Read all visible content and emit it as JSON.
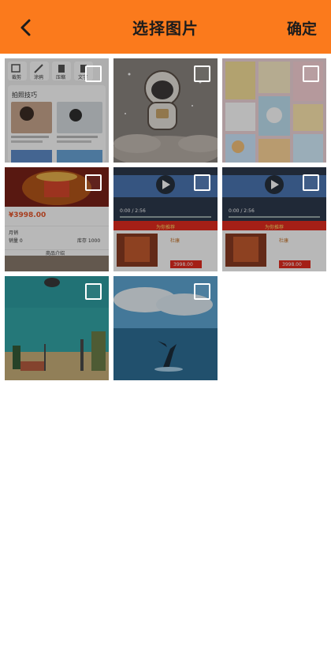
{
  "header": {
    "title": "选择图片",
    "confirm_label": "确定",
    "back_icon": "chevron-left-icon",
    "background": "#fb7a1c"
  },
  "tile1": {
    "toolbar": [
      "裁剪",
      "涂鸦",
      "压缩",
      "文字"
    ],
    "heading": "拍照技巧"
  },
  "tile4": {
    "price": "¥3998.00",
    "label_a": "月销",
    "label_b": "销量 0",
    "label_c": "库存 1000",
    "section": "商品介绍"
  },
  "tile5": {
    "time": "0:00 / 2:56",
    "banner": "为你推荐",
    "product": "杜康",
    "price": "3998.00"
  },
  "tile6": {
    "time": "0:00 / 2:56",
    "banner": "为你推荐",
    "product": "杜康",
    "price": "3998.00"
  }
}
